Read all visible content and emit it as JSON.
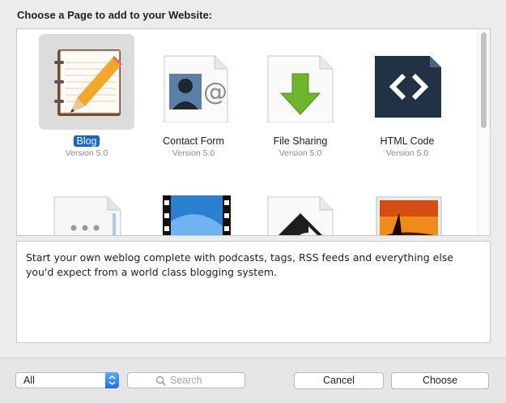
{
  "dialog": {
    "heading": "Choose a Page to add to your Website:"
  },
  "tiles": [
    {
      "name": "Blog",
      "version": "Version 5.0",
      "icon": "blog-icon",
      "selected": true
    },
    {
      "name": "Contact Form",
      "version": "Version 5.0",
      "icon": "contact-form-icon"
    },
    {
      "name": "File Sharing",
      "version": "Version 5.0",
      "icon": "file-sharing-icon"
    },
    {
      "name": "HTML Code",
      "version": "Version 5.0",
      "icon": "html-code-icon"
    },
    {
      "name": "",
      "version": "",
      "icon": "more-page-icon"
    },
    {
      "name": "",
      "version": "",
      "icon": "movie-page-icon"
    },
    {
      "name": "",
      "version": "",
      "icon": "redirect-page-icon"
    },
    {
      "name": "",
      "version": "",
      "icon": "photo-page-icon"
    }
  ],
  "description": "Start your own weblog complete with podcasts, tags, RSS feeds and everything else you'd expect from a world class blogging system.",
  "footer": {
    "filter_value": "All",
    "search_placeholder": "Search",
    "cancel_label": "Cancel",
    "choose_label": "Choose"
  },
  "colors": {
    "selection": "#1862d1",
    "accent": "#1e6ff1"
  }
}
